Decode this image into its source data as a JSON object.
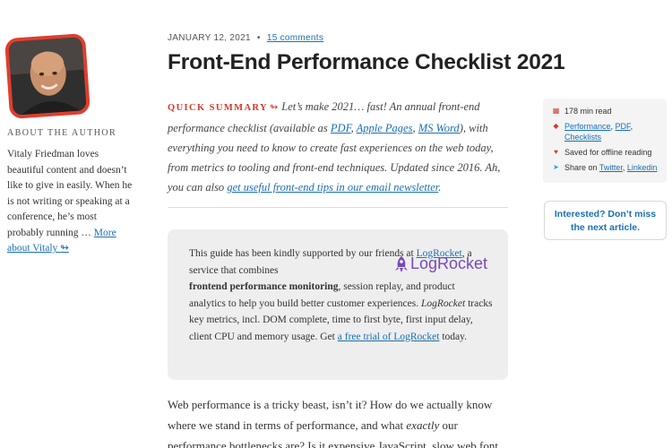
{
  "author": {
    "about_heading": "About The Author",
    "bio": "Vitaly Friedman loves beautiful content and doesn’t like to give in easily. When he is not writing or speaking at a conference, he’s most probably running …",
    "more_link": "More about Vitaly",
    "more_arrow": "↬"
  },
  "meta": {
    "date": "January 12, 2021",
    "separator": "•",
    "comments_link": "15 comments"
  },
  "article": {
    "title": "Front-End Performance Checklist 2021",
    "summary_label": "Quick Summary",
    "summary_arrow": "↬",
    "summary_part1": "Let’s make 2021… fast! An annual front-end performance checklist (available as ",
    "link_pdf": "PDF",
    "comma1": ", ",
    "link_apple": "Apple Pages",
    "comma2": ", ",
    "link_msword": "MS Word",
    "summary_part2": "), with everything you need to know to create fast experiences on the web today, from metrics to tooling and front-end techniques. Updated since 2016. Ah, you can also ",
    "newsletter_link": "get useful front-end tips in our email newsletter",
    "period": ".",
    "body_part1": "Web performance is a tricky beast, isn’t it? How do we actually know where we stand in terms of performance, and what ",
    "body_em": "exactly",
    "body_part2": " our performance bottlenecks are? Is it expensive JavaScript, slow web font"
  },
  "sponsor": {
    "text1": "This guide has been kindly supported by our friends at ",
    "link_logrocket": "LogRocket",
    "text2": ", a service that combines ",
    "bold": "frontend performance monitoring",
    "text3": ", session replay, and product analytics to help you build better customer experiences. ",
    "em_logrocket": "LogRocket",
    "text4": " tracks key metrics, incl. DOM complete, time to first byte, first input delay, client CPU and memory usage. Get ",
    "trial_link": "a free trial of LogRocket",
    "text5": " today.",
    "logo_text": "LogRocket",
    "logo_icon": "rocket-icon",
    "logo_color": "#764abc"
  },
  "info": {
    "read_time": "178 min read",
    "tag1": "Performance",
    "tag_comma1": ", ",
    "tag2": "PDF",
    "tag_comma2": ",",
    "tag3": "Checklists",
    "offline": "Saved for offline reading",
    "share_label": "Share on ",
    "share_twitter": "Twitter",
    "share_comma": ", ",
    "share_linkedin": "Linkedin"
  },
  "next": {
    "line1": "Interested? Don’t miss",
    "line2": "the next article."
  },
  "colors": {
    "accent_red": "#d33a2c",
    "link_blue": "#1a6fb5",
    "avatar_border": "#e03e2d"
  }
}
